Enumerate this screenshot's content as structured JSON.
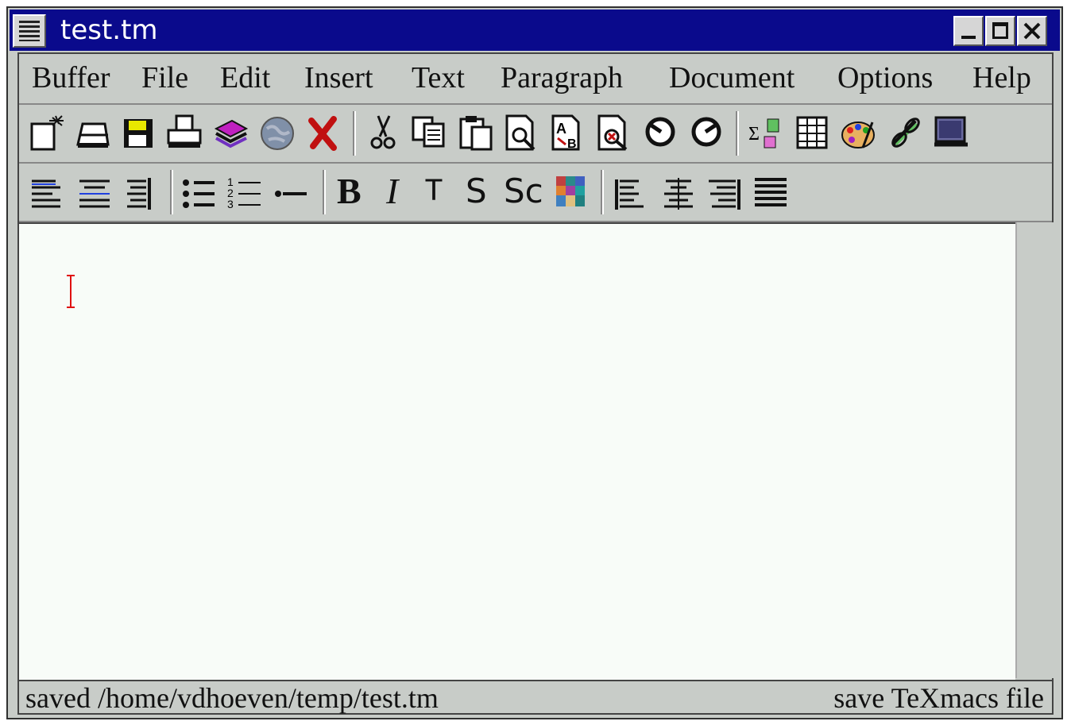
{
  "window": {
    "title": "test.tm"
  },
  "menubar": [
    "Buffer",
    "File",
    "Edit",
    "Insert",
    "Text",
    "Paragraph",
    "Document",
    "Options",
    "Help"
  ],
  "toolbar_main": [
    "new-document-icon",
    "open-icon",
    "save-icon",
    "print-icon",
    "books-icon",
    "globe-icon",
    "close-document-icon",
    "cut-icon",
    "copy-icon",
    "paste-icon",
    "find-icon",
    "replace-icon",
    "spell-icon",
    "undo-icon",
    "redo-icon",
    "math-icon",
    "table-icon",
    "palette-icon",
    "link-icon",
    "session-icon"
  ],
  "toolbar_format": {
    "bold": "B",
    "italic": "I",
    "typewriter": "T",
    "sans": "S",
    "smallcaps": "Sc"
  },
  "status": {
    "left": "saved /home/vdhoeven/temp/test.tm",
    "right": "save TeXmacs file"
  },
  "colors": {
    "titlebar": "#0a0a8c",
    "cursor": "#e01010",
    "editor_bg": "#f8fcf8"
  }
}
